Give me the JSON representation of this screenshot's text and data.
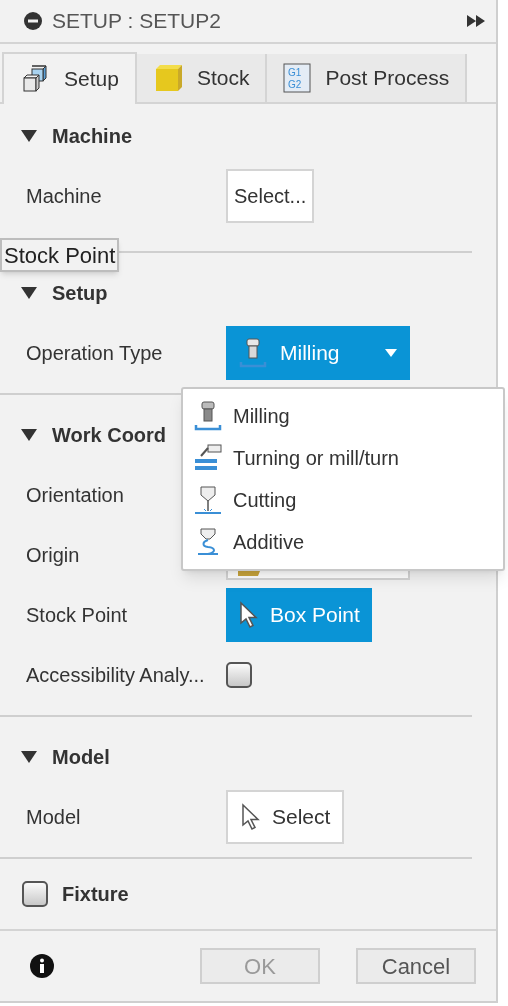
{
  "title": "SETUP : SETUP2",
  "tabs": [
    {
      "label": "Setup",
      "kind": "setup",
      "selected": true
    },
    {
      "label": "Stock",
      "kind": "stock",
      "selected": false
    },
    {
      "label": "Post Process",
      "kind": "post",
      "icon_text": [
        "G1",
        "G2"
      ],
      "selected": false
    }
  ],
  "sections": [
    {
      "title": "Machine",
      "expanded": true,
      "rows": [
        {
          "label": "Machine",
          "control": {
            "kind": "button",
            "text": "Select..."
          }
        }
      ]
    },
    {
      "title": "Setup",
      "expanded": true,
      "rows": [
        {
          "label": "Operation Type",
          "control": {
            "kind": "dropdown",
            "text": "Milling"
          }
        }
      ]
    },
    {
      "title": "Work Coord",
      "expanded": true,
      "rows": [
        {
          "label": "Orientation",
          "control": {
            "kind": "hidden"
          }
        },
        {
          "label": "Origin",
          "control": {
            "kind": "field"
          }
        },
        {
          "label": "Stock Point",
          "control": {
            "kind": "pick",
            "text": "Box Point",
            "active": true
          }
        },
        {
          "label": "Accessibility Analy...",
          "control": {
            "kind": "checkbox",
            "checked": false
          }
        }
      ]
    },
    {
      "title": "Model",
      "expanded": true,
      "rows": [
        {
          "label": "Model",
          "control": {
            "kind": "pick",
            "text": "Select",
            "active": false
          }
        }
      ]
    }
  ],
  "fixture": {
    "label": "Fixture",
    "checked": false
  },
  "footer_buttons": [
    {
      "label": "OK",
      "disabled": true
    },
    {
      "label": "Cancel",
      "disabled": false
    }
  ],
  "menu": [
    {
      "label": "Milling",
      "kind": "milling"
    },
    {
      "label": "Turning or mill/turn",
      "kind": "turning"
    },
    {
      "label": "Cutting",
      "kind": "cutting"
    },
    {
      "label": "Additive",
      "kind": "additive"
    }
  ],
  "tooltip": "Stock Point"
}
